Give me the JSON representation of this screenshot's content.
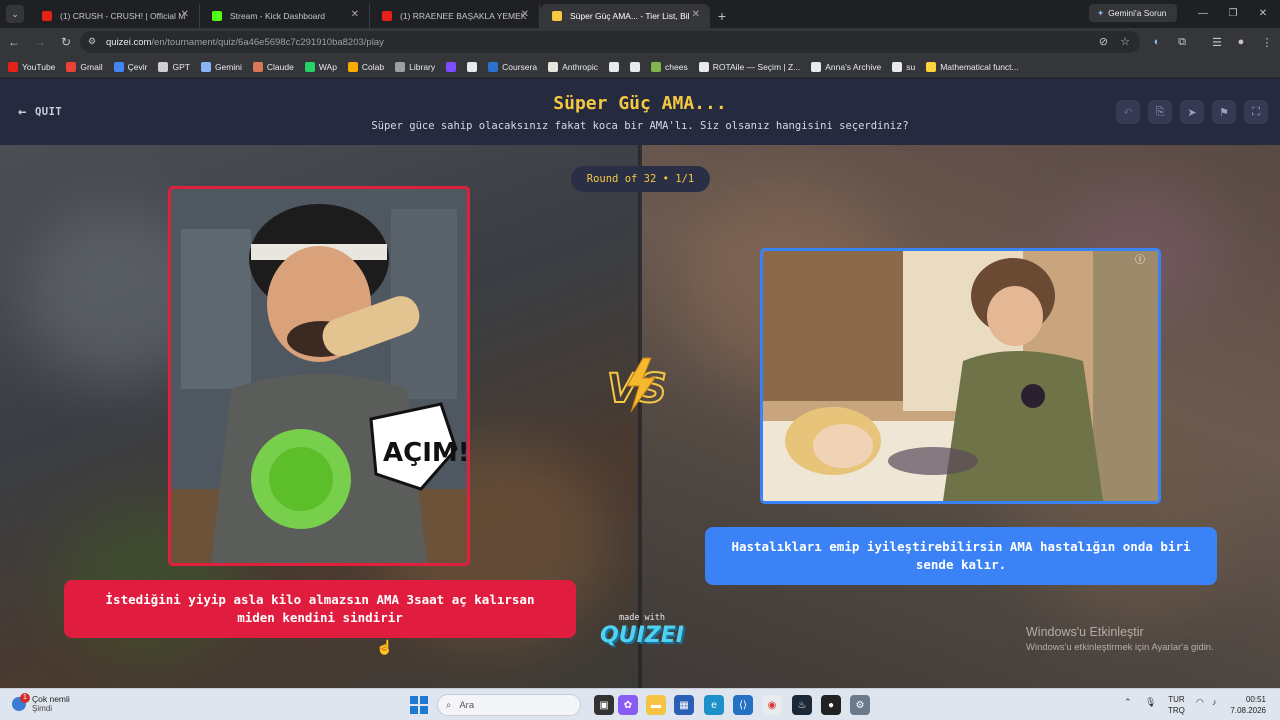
{
  "browser": {
    "tabs": [
      {
        "title": "(1) CRUSH - CRUSH! | Official M",
        "favicon_color": "#e62117",
        "active": false
      },
      {
        "title": "Stream - Kick Dashboard",
        "favicon_color": "#53fc18",
        "active": false
      },
      {
        "title": "(1) RRAENEE BAŞAKLA YEMEK",
        "favicon_color": "#e62117",
        "active": false
      },
      {
        "title": "Süper Güç AMA... - Tier List, Bil",
        "favicon_color": "#f5c842",
        "active": true
      }
    ],
    "gemini_button": "Gemini'a Sorun",
    "url_host": "quizei.com",
    "url_path": "/en/tournament/quiz/6a46e5698c7c291910ba8203/play",
    "bookmarks": [
      {
        "label": "YouTube",
        "color": "#e62117"
      },
      {
        "label": "Gmail",
        "color": "#ea4335"
      },
      {
        "label": "Çevir",
        "color": "#4285f4"
      },
      {
        "label": "GPT",
        "color": "#cfcfcf"
      },
      {
        "label": "Gemini",
        "color": "#8ab4f8"
      },
      {
        "label": "Claude",
        "color": "#d97757"
      },
      {
        "label": "WAp",
        "color": "#25d366"
      },
      {
        "label": "Colab",
        "color": "#f9ab00"
      },
      {
        "label": "Library",
        "color": "#9aa0a6"
      },
      {
        "label": "",
        "color": "#7c4dff"
      },
      {
        "label": "",
        "color": "#e8eaed"
      },
      {
        "label": "Coursera",
        "color": "#2a73cc"
      },
      {
        "label": "Anthropic",
        "color": "#e8e6dc"
      },
      {
        "label": "",
        "color": "#e8eaed"
      },
      {
        "label": "",
        "color": "#e8eaed"
      },
      {
        "label": "chees",
        "color": "#81b64c"
      },
      {
        "label": "ROTAile — Seçim | Z...",
        "color": "#e8eaed"
      },
      {
        "label": "Anna's Archive",
        "color": "#e8eaed"
      },
      {
        "label": "su",
        "color": "#e8eaed"
      },
      {
        "label": "Mathematical funct...",
        "color": "#ffd43b"
      }
    ]
  },
  "quiz": {
    "quit_label": "QUIT",
    "title": "Süper Güç AMA...",
    "subtitle": "Süper güce sahip olacaksınız fakat koca bir AMA'lı. Siz olsanız hangisini seçerdiniz?",
    "round_label": "Round of 32 • 1/1",
    "left_option": "İstediğini yiyip asla kilo almazsın AMA 3saat aç kalırsan miden kendini sindirir",
    "right_option": "Hastalıkları emip iyileştirebilirsin AMA hastalığın onda biri sende kalır.",
    "left_image_text": "AÇIM!",
    "made_with": "made with",
    "brand": "QUIZEI",
    "left_color": "#e11d3f",
    "right_color": "#3b82f6",
    "title_color": "#f5c842"
  },
  "windows": {
    "activate_title": "Windows'u Etkinleştir",
    "activate_sub": "Windows'u etkinleştirmek için Ayarlar'a gidin.",
    "weather_line1": "Çok nemli",
    "weather_line2": "Şimdi",
    "weather_badge": "1",
    "search_label": "Ara",
    "lang_top": "TUR",
    "lang_bottom": "TRQ",
    "time": "00:51",
    "date": "7.08.2026"
  }
}
